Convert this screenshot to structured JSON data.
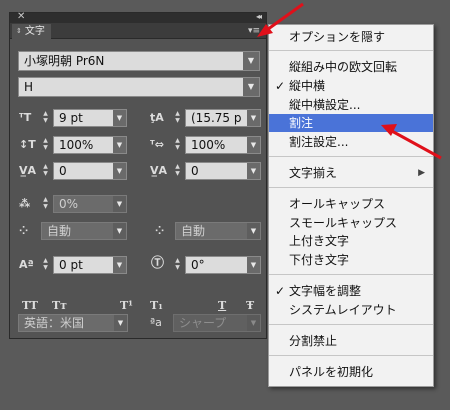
{
  "panel": {
    "tab_label": "文字",
    "font_family": "小塚明朝 Pr6N",
    "font_style": "H",
    "font_size": "9 pt",
    "leading": "(15.75 p",
    "vertical_scale": "100%",
    "horizontal_scale": "100%",
    "kerning": "0",
    "tracking": "0",
    "tsume": "0%",
    "aki_left": "自動",
    "aki_right": "自動",
    "baseline_shift": "0 pt",
    "rotation": "0°",
    "language": "英語：米国",
    "antialias": "シャープ",
    "type_buttons": [
      "TT",
      "Tт",
      "T¹",
      "T₁",
      "T",
      "Ŧ"
    ]
  },
  "menu": {
    "items": [
      {
        "label": "オプションを隠す",
        "checked": false
      },
      {
        "label": "縦組み中の欧文回転",
        "checked": false
      },
      {
        "label": "縦中横",
        "checked": true
      },
      {
        "label": "縦中横設定...",
        "checked": false
      },
      {
        "label": "割注",
        "checked": false,
        "highlighted": true
      },
      {
        "label": "割注設定...",
        "checked": false
      },
      {
        "label": "文字揃え",
        "checked": false,
        "submenu": true
      },
      {
        "label": "オールキャップス",
        "checked": false
      },
      {
        "label": "スモールキャップス",
        "checked": false
      },
      {
        "label": "上付き文字",
        "checked": false
      },
      {
        "label": "下付き文字",
        "checked": false
      },
      {
        "label": "文字幅を調整",
        "checked": true
      },
      {
        "label": "システムレイアウト",
        "checked": false
      },
      {
        "label": "分割禁止",
        "checked": false
      },
      {
        "label": "パネルを初期化",
        "checked": false
      }
    ],
    "check_glyph": "✓",
    "submenu_glyph": "▶"
  },
  "colors": {
    "highlight": "#4a73d8",
    "annotation_arrow": "#e0101a"
  }
}
